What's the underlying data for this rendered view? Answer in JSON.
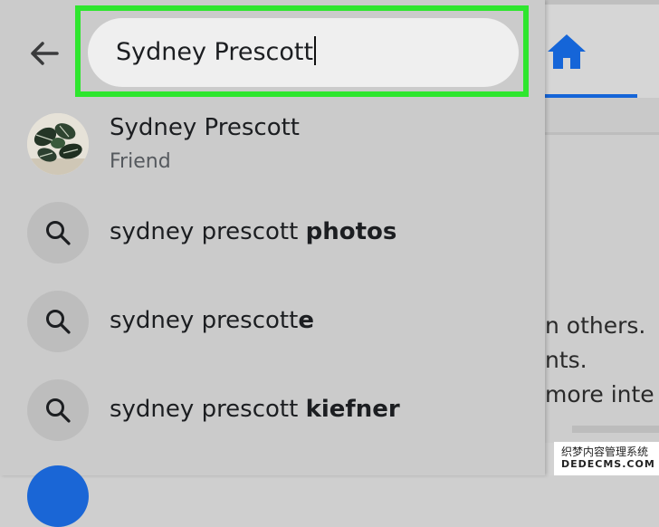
{
  "search": {
    "query": "Sydney Prescott"
  },
  "suggestions": {
    "person": {
      "name": "Sydney Prescott",
      "relation": "Friend"
    },
    "queries": [
      {
        "prefix": "sydney prescott ",
        "bold": "photos"
      },
      {
        "prefix": "sydney prescott",
        "bold": "e"
      },
      {
        "prefix": "sydney prescott ",
        "bold": "kiefner"
      }
    ]
  },
  "background": {
    "text_lines": [
      "n others.",
      "nts.",
      " more inte"
    ]
  },
  "watermark": {
    "line1": "织梦内容管理系统",
    "line2": "DEDECMS.COM"
  },
  "colors": {
    "highlight": "#2ee62e",
    "accent": "#1565d8"
  }
}
